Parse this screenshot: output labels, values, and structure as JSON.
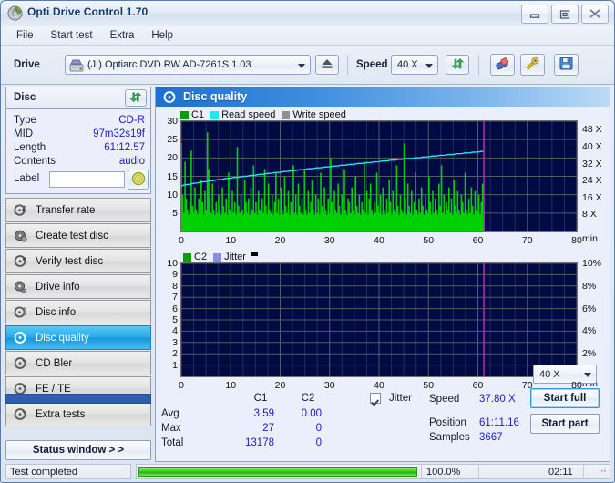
{
  "window": {
    "title": "Opti Drive Control 1.70",
    "icon": "disc-icon",
    "buttons": {
      "minimize": "minimize-icon",
      "maximize": "maximize-icon",
      "close": "close-icon"
    }
  },
  "menu": {
    "items": [
      "File",
      "Start test",
      "Extra",
      "Help"
    ]
  },
  "toolbar": {
    "drive_label": "Drive",
    "drive_value": "(J:)   Optiarc DVD RW AD-7261S 1.03",
    "drive_icon": "drive-icon",
    "eject_icon": "eject-icon",
    "speed_label": "Speed",
    "speed_value": "40 X",
    "refresh_icon": "refresh-icon",
    "eraser_icon": "eraser-icon",
    "tools_icon": "wrench-icon",
    "save_icon": "save-icon"
  },
  "disc_panel": {
    "header": "Disc",
    "refresh_icon": "refresh-icon",
    "rows": [
      {
        "key": "Type",
        "value": "CD-R"
      },
      {
        "key": "MID",
        "value": "97m32s19f"
      },
      {
        "key": "Length",
        "value": "61:12.57"
      },
      {
        "key": "Contents",
        "value": "audio"
      }
    ],
    "label_key": "Label",
    "label_value": "",
    "label_placeholder": "",
    "label_button_icon": "cd-icon"
  },
  "nav": {
    "items": [
      {
        "label": "Transfer rate",
        "icon": "disc-rate-icon",
        "selected": false
      },
      {
        "label": "Create test disc",
        "icon": "disc-create-icon",
        "selected": false
      },
      {
        "label": "Verify test disc",
        "icon": "disc-verify-icon",
        "selected": false
      },
      {
        "label": "Drive info",
        "icon": "disc-drive-icon",
        "selected": false
      },
      {
        "label": "Disc info",
        "icon": "disc-info-icon",
        "selected": false
      },
      {
        "label": "Disc quality",
        "icon": "disc-quality-icon",
        "selected": true
      },
      {
        "label": "CD Bler",
        "icon": "disc-bler-icon",
        "selected": false
      },
      {
        "label": "FE / TE",
        "icon": "disc-fete-icon",
        "selected": false
      },
      {
        "label": "Extra tests",
        "icon": "disc-extra-icon",
        "selected": false
      }
    ],
    "status_window_button": "Status window > >"
  },
  "status": {
    "text": "Test completed",
    "progress_percent": "100.0%",
    "elapsed": "02:11",
    "progress_value": 100
  },
  "main": {
    "title": "Disc quality",
    "icon": "disc-quality-icon"
  },
  "stats": {
    "col_headers": [
      "C1",
      "C2"
    ],
    "rows": [
      {
        "label": "Avg",
        "c1": "3.59",
        "c2": "0.00"
      },
      {
        "label": "Max",
        "c1": "27",
        "c2": "0"
      },
      {
        "label": "Total",
        "c1": "13178",
        "c2": "0"
      }
    ],
    "jitter_label": "Jitter",
    "jitter_checked": true,
    "speed_label": "Speed",
    "speed_value": "37.80 X",
    "position_label": "Position",
    "position_value": "61:11.16",
    "samples_label": "Samples",
    "samples_value": "3667",
    "speed_select": "40 X",
    "start_full": "Start full",
    "start_part": "Start part"
  },
  "chart_data": [
    {
      "type": "area",
      "id": "c1-chart",
      "title": "",
      "legend": [
        {
          "name": "C1",
          "color": "#00a000"
        },
        {
          "name": "Read speed",
          "color": "#1ee8f0"
        },
        {
          "name": "Write speed",
          "color": "#909090"
        }
      ],
      "legend_position": "top-left",
      "xlabel": "min",
      "ylabel": "",
      "xlim": [
        0,
        80
      ],
      "ylim": [
        0,
        30
      ],
      "xticks": [
        0,
        10,
        20,
        30,
        40,
        50,
        60,
        70,
        80
      ],
      "yticks": [
        5,
        10,
        15,
        20,
        25,
        30
      ],
      "y2label": "X",
      "y2lim": [
        0,
        52
      ],
      "y2ticks": [
        8,
        16,
        24,
        32,
        40,
        48
      ],
      "y2ticklabels": [
        "8 X",
        "16 X",
        "24 X",
        "32 X",
        "40 X",
        "48 X"
      ],
      "grid": true,
      "background": "#000b44",
      "data_end_x": 61.2,
      "marker_line_x": 61.2,
      "marker_line_color": "#c828c8",
      "series": [
        {
          "name": "C1",
          "color": "#00d000",
          "baseline_mean": 3.59,
          "max": 27,
          "total": 13178,
          "samples": 3667,
          "values": [
            24,
            10,
            5,
            19,
            9,
            6,
            4,
            8,
            22,
            7,
            5,
            12,
            6,
            4,
            9,
            5,
            14,
            8,
            4,
            11,
            6,
            27,
            17,
            9,
            5,
            13,
            6,
            4,
            8,
            5,
            10,
            6,
            4,
            12,
            7,
            5,
            9,
            4,
            16,
            6,
            4,
            11,
            5,
            8,
            4,
            23,
            7,
            5,
            10,
            6,
            4,
            14,
            8,
            5,
            9,
            4,
            12,
            6,
            18,
            5,
            8,
            4,
            11,
            6,
            4,
            9,
            5,
            17,
            7,
            4,
            13,
            6,
            5,
            10,
            4,
            8,
            16,
            5,
            9,
            4,
            12,
            6,
            4,
            15,
            7,
            5,
            11,
            4,
            8,
            6,
            18,
            5,
            10,
            4,
            13,
            7,
            5,
            9,
            4,
            17,
            6,
            4,
            11,
            5,
            8,
            14,
            6,
            4,
            10,
            5,
            9,
            4,
            16,
            7,
            5,
            12,
            6,
            4,
            9,
            5,
            20,
            8,
            4,
            11,
            6,
            5,
            13,
            7,
            4,
            10,
            5,
            17,
            6,
            4,
            9,
            8,
            5,
            12,
            6,
            4,
            15,
            7,
            5,
            10,
            4,
            8,
            6,
            19,
            5,
            11,
            4,
            9,
            13,
            6,
            4,
            8,
            5,
            16,
            7,
            5,
            10,
            4,
            12,
            6,
            4,
            9,
            5,
            14,
            8,
            4,
            11,
            6,
            5,
            18,
            7,
            4,
            10,
            6,
            5,
            24,
            9,
            4,
            13,
            7,
            5,
            11,
            4,
            8,
            16,
            6,
            4,
            9,
            5,
            12,
            7,
            4,
            10,
            6,
            5,
            15,
            8,
            4,
            11,
            5,
            9,
            6,
            4,
            13,
            7,
            18,
            5,
            10,
            4,
            8,
            6,
            12,
            5,
            9,
            4,
            14,
            7,
            5,
            11,
            6,
            4,
            10,
            8,
            5,
            16,
            6,
            4,
            9,
            5,
            12,
            7,
            4,
            11,
            6,
            5,
            10,
            4,
            8,
            13,
            6
          ]
        },
        {
          "name": "Read speed",
          "color": "#1ee8f0",
          "unit": "X",
          "start_value": 21.5,
          "end_value": 37.8,
          "description": "CAV ramp rising steadily from about 21.5X at 0 min to 37.8X at 61 min"
        },
        {
          "name": "Write speed",
          "color": "#909090",
          "values": []
        }
      ]
    },
    {
      "type": "area",
      "id": "c2-jitter-chart",
      "title": "",
      "legend": [
        {
          "name": "C2",
          "color": "#00a000"
        },
        {
          "name": "Jitter",
          "color": "#8a8ae8"
        }
      ],
      "legend_position": "top-left",
      "xlabel": "min",
      "ylabel": "",
      "xlim": [
        0,
        80
      ],
      "ylim": [
        0,
        10
      ],
      "xticks": [
        0,
        10,
        20,
        30,
        40,
        50,
        60,
        70,
        80
      ],
      "yticks": [
        1,
        2,
        3,
        4,
        5,
        6,
        7,
        8,
        9,
        10
      ],
      "y2lim": [
        0,
        10
      ],
      "y2ticks": [
        2,
        4,
        6,
        8,
        10
      ],
      "y2ticklabels": [
        "2%",
        "4%",
        "6%",
        "8%",
        "10%"
      ],
      "grid": true,
      "background": "#000b44",
      "marker_line_x": 61.2,
      "marker_line_color": "#c828c8",
      "series": [
        {
          "name": "C2",
          "color": "#00d000",
          "values": [],
          "max": 0,
          "total": 0,
          "avg": 0.0
        },
        {
          "name": "Jitter",
          "color": "#8a8ae8",
          "values": []
        }
      ]
    }
  ]
}
